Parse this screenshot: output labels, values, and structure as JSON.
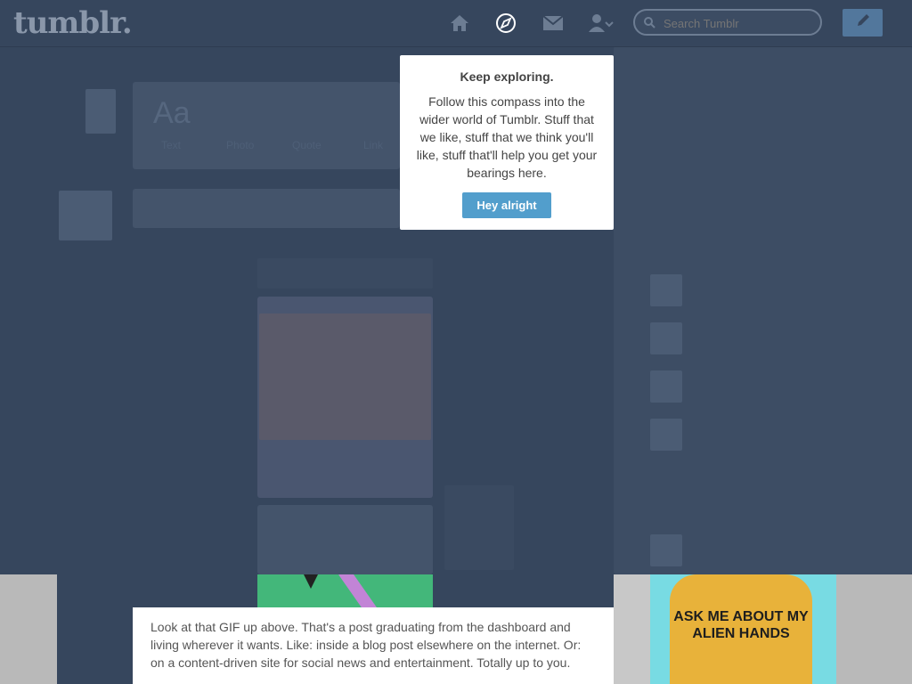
{
  "header": {
    "logo": "tumblr.",
    "search_placeholder": "Search Tumblr",
    "icons": [
      "home-icon",
      "compass-icon",
      "mail-icon",
      "account-icon"
    ],
    "compose_icon": "pencil-icon"
  },
  "dashboard_ghost": {
    "post_types": [
      "Aa",
      "Text",
      "Photo",
      "Quote",
      "Link"
    ]
  },
  "tooltip": {
    "title": "Keep exploring.",
    "body": "Follow this compass into the wider world of Tumblr. Stuff that we like, stuff that we think you'll like, stuff that'll help you get your bearings here.",
    "button": "Hey alright"
  },
  "article": {
    "text": "Look at that GIF up above. That's a post graduating from the dashboard and living wherever it wants. Like: inside a blog post elsewhere on the internet. Or: on a content-driven site for social news and entertainment. Totally up to you."
  },
  "ad": {
    "shirt_text": "ASK ME ABOUT MY ALIEN HANDS"
  },
  "colors": {
    "overlay": "#36465d",
    "accent_button": "#529ecc",
    "compose": "#52779c",
    "post_green": "#43b77a"
  }
}
